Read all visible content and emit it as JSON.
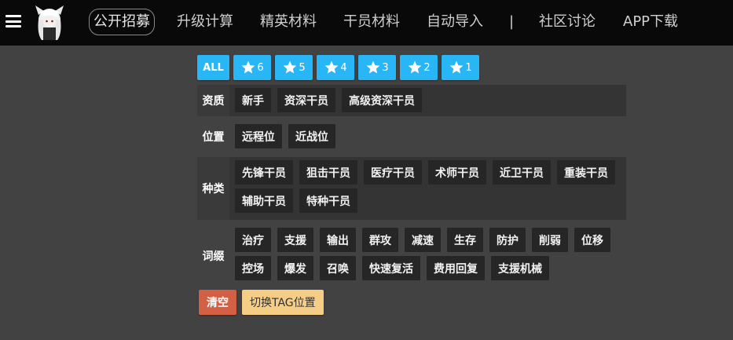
{
  "nav": {
    "menu_icon": "hamburger-menu-icon",
    "logo_icon": "character-avatar-icon",
    "items": [
      {
        "label": "公开招募",
        "active": true
      },
      {
        "label": "升级计算"
      },
      {
        "label": "精英材料"
      },
      {
        "label": "干员材料"
      },
      {
        "label": "自动导入"
      },
      {
        "label": "|"
      },
      {
        "label": "社区讨论"
      },
      {
        "label": "APP下载"
      }
    ]
  },
  "rarity": {
    "all_label": "ALL",
    "star_icon": "star-icon",
    "stars": [
      "6",
      "5",
      "4",
      "3",
      "2",
      "1"
    ],
    "color": "#29b6f6"
  },
  "tags": {
    "qualification": {
      "label": "资质",
      "items": [
        "新手",
        "资深干员",
        "高级资深干员"
      ]
    },
    "position": {
      "label": "位置",
      "items": [
        "远程位",
        "近战位"
      ]
    },
    "class": {
      "label": "种类",
      "items": [
        "先锋干员",
        "狙击干员",
        "医疗干员",
        "术师干员",
        "近卫干员",
        "重装干员",
        "辅助干员",
        "特种干员"
      ]
    },
    "affix": {
      "label": "词缀",
      "items": [
        "治疗",
        "支援",
        "输出",
        "群攻",
        "减速",
        "生存",
        "防护",
        "削弱",
        "位移",
        "控场",
        "爆发",
        "召唤",
        "快速复活",
        "费用回复",
        "支援机械"
      ]
    }
  },
  "actions": {
    "clear_label": "清空",
    "clear_color": "#d35f45",
    "switch_label": "切换TAG位置",
    "switch_color": "#f5cd85"
  }
}
